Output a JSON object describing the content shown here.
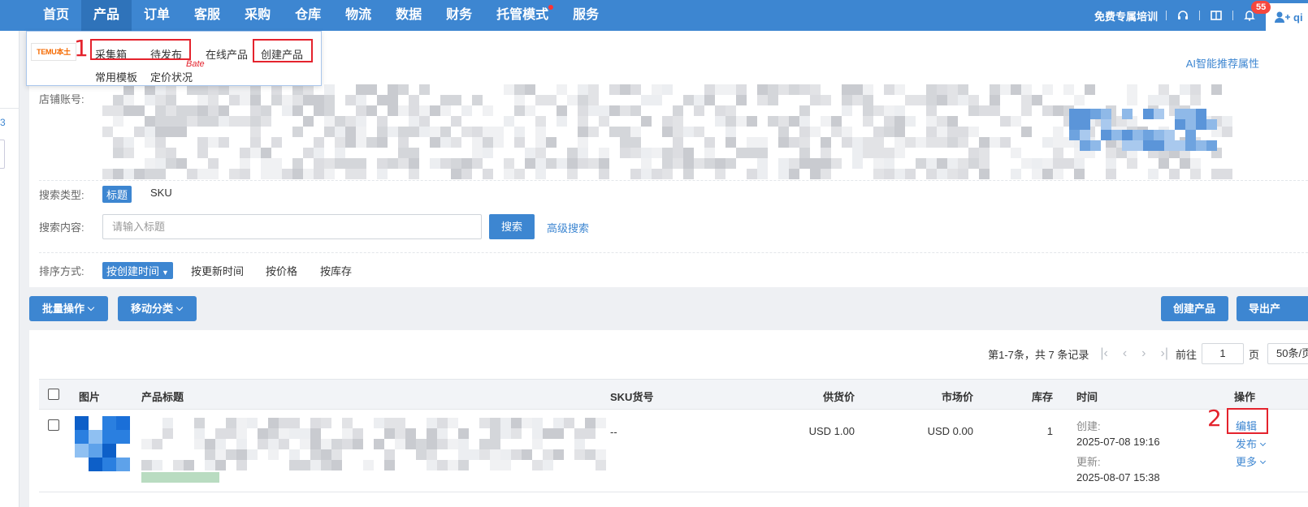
{
  "nav": {
    "items": [
      "首页",
      "产品",
      "订单",
      "客服",
      "采购",
      "仓库",
      "物流",
      "数据",
      "财务",
      "托管模式",
      "服务"
    ],
    "active_index": 1,
    "training": "免费专属培训",
    "notif_count": "55",
    "user_initial": "qi"
  },
  "dropdown": {
    "logo": "TEMU本土",
    "row1": [
      "采集箱",
      "待发布",
      "在线产品",
      "创建产品"
    ],
    "row2": [
      "常用模板",
      "定价状况"
    ],
    "beta": "Bate",
    "annot1": "1"
  },
  "left": {
    "num": "3"
  },
  "filters": {
    "ai_link": "AI智能推荐属性",
    "store_label": "店铺账号:",
    "search_type_label": "搜索类型:",
    "search_types": [
      "标题",
      "SKU"
    ],
    "search_content_label": "搜索内容:",
    "search_placeholder": "请输入标题",
    "search_button": "搜索",
    "advanced": "高级搜索",
    "sort_label": "排序方式:",
    "sort_options": [
      "按创建时间",
      "按更新时间",
      "按价格",
      "按库存"
    ]
  },
  "toolbar": {
    "batch": "批量操作",
    "move": "移动分类",
    "create": "创建产品",
    "export": "导出产"
  },
  "pager": {
    "summary": "第1-7条，共 7 条记录",
    "goto": "前往",
    "page": "1",
    "page_unit": "页",
    "size": "50条/页"
  },
  "table": {
    "headers": {
      "image": "图片",
      "title": "产品标题",
      "sku": "SKU货号",
      "supply": "供货价",
      "market": "市场价",
      "stock": "库存",
      "time": "时间",
      "ops": "操作"
    },
    "rows": [
      {
        "sku": "--",
        "supply": "USD 1.00",
        "market": "USD 0.00",
        "stock": "1",
        "created_label": "创建:",
        "created": "2025-07-08 19:16",
        "updated_label": "更新:",
        "updated": "2025-08-07 15:38",
        "edit": "编辑",
        "publish": "发布",
        "more": "更多"
      }
    ],
    "annot2": "2"
  },
  "colors": {
    "primary": "#3d86d1",
    "annotation": "#e4232d"
  }
}
